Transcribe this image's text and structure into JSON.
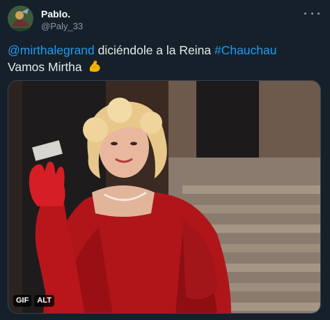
{
  "author": {
    "display_name": "Pablo.",
    "handle": "@Paly_33",
    "avatar_icon": "avatar-photo"
  },
  "menu_icon": "more-horizontal-icon",
  "tweet": {
    "mention": "@mirthalegrand",
    "text_mid": " diciéndole a la Reina ",
    "hashtag": "#Chauchau",
    "line2": "Vamos Mirtha",
    "emoji_icon": "flexed-biceps-icon"
  },
  "media": {
    "gif_badge": "GIF",
    "alt_badge": "ALT"
  },
  "colors": {
    "background": "#15202b",
    "link": "#1d9bf0",
    "secondary_text": "#8b98a5",
    "border": "#38444d"
  }
}
